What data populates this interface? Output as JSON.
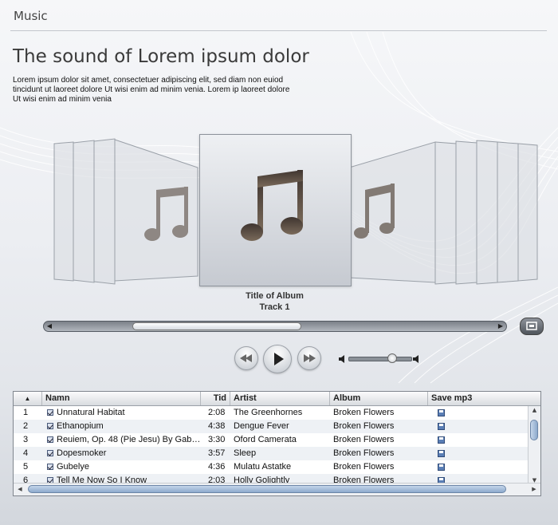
{
  "header": {
    "app_title": "Music"
  },
  "hero": {
    "headline": "The sound of Lorem ipsum dolor",
    "intro": "Lorem ipsum dolor sit amet, consectetuer adipiscing elit, sed diam non euiod tincidunt ut laoreet dolore  Ut wisi enim ad minim venia. Lorem ip laoreet dolore  Ut wisi enim ad minim venia"
  },
  "coverflow": {
    "album_title": "Title of Album",
    "track_label": "Track 1",
    "cover_icon": "music-note-icon"
  },
  "scrollbar": {
    "position_percent": 19
  },
  "player": {
    "rewind_icon": "rewind-icon",
    "play_icon": "play-icon",
    "forward_icon": "fast-forward-icon",
    "volume_percent": 68
  },
  "tracklist": {
    "columns": [
      "",
      "Namn",
      "Tid",
      "Artist",
      "Album",
      "Save mp3"
    ],
    "rows": [
      {
        "n": "1",
        "name": "Unnatural Habitat",
        "time": "2:08",
        "artist": "The Greenhornes",
        "album": "Broken Flowers"
      },
      {
        "n": "2",
        "name": "Ethanopium",
        "time": "4:38",
        "artist": "Dengue Fever",
        "album": "Broken Flowers"
      },
      {
        "n": "3",
        "name": "Reuiem, Op. 48 (Pie Jesu) By Gab…",
        "time": "3:30",
        "artist": "Oford Camerata",
        "album": "Broken Flowers"
      },
      {
        "n": "4",
        "name": "Dopesmoker",
        "time": "3:57",
        "artist": "Sleep",
        "album": "Broken Flowers"
      },
      {
        "n": "5",
        "name": "Gubelye",
        "time": "4:36",
        "artist": "Mulatu Astatke",
        "album": "Broken Flowers"
      },
      {
        "n": "6",
        "name": "Tell Me Now So I Know",
        "time": "2:03",
        "artist": "Holly Golightly",
        "album": "Broken Flowers"
      }
    ]
  },
  "colors": {
    "background": "#e8eaee",
    "accent": "#5b7fb6",
    "note": "#5b5048"
  }
}
